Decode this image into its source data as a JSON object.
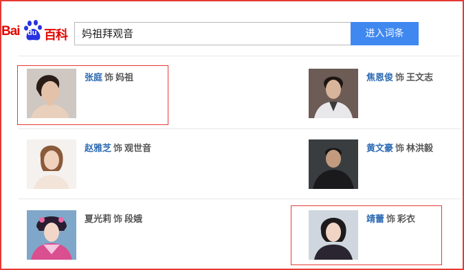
{
  "logo": {
    "bai": "Bai",
    "du": "du",
    "baike": "百科"
  },
  "search": {
    "query": "妈祖拜观音",
    "button_label": "进入词条"
  },
  "shi": "饰",
  "roles": [
    {
      "actor": "张庭",
      "character": "妈祖",
      "linked": true
    },
    {
      "actor": "焦恩俊",
      "character": "王文志",
      "linked": true
    },
    {
      "actor": "赵雅芝",
      "character": "观世音",
      "linked": true
    },
    {
      "actor": "黄文豪",
      "character": "林洪毅",
      "linked": true
    },
    {
      "actor": "夏光莉",
      "character": "段娥",
      "linked": false
    },
    {
      "actor": "靖蕾",
      "character": "彩衣",
      "linked": true
    }
  ],
  "colors": {
    "link": "#2d6bb3",
    "button": "#3f88f0",
    "highlight": "#e53935",
    "brand": "#e10601"
  }
}
